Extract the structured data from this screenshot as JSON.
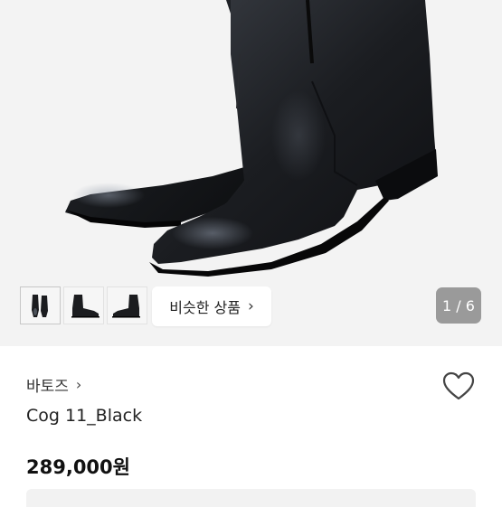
{
  "gallery": {
    "thumbnails": [
      {
        "icon": "boots-front-icon"
      },
      {
        "icon": "boot-side-icon"
      },
      {
        "icon": "boot-side-icon"
      }
    ],
    "similar_label": "비슷한 상품",
    "pager": "1 / 6"
  },
  "product": {
    "shop_name": "바토즈",
    "title": "Cog 11_Black",
    "price": "289,000원"
  },
  "colors": {
    "gallery_bg": "#f3f3f3",
    "pager_bg": "#9a9a9a",
    "boot": "#1c1e22"
  }
}
